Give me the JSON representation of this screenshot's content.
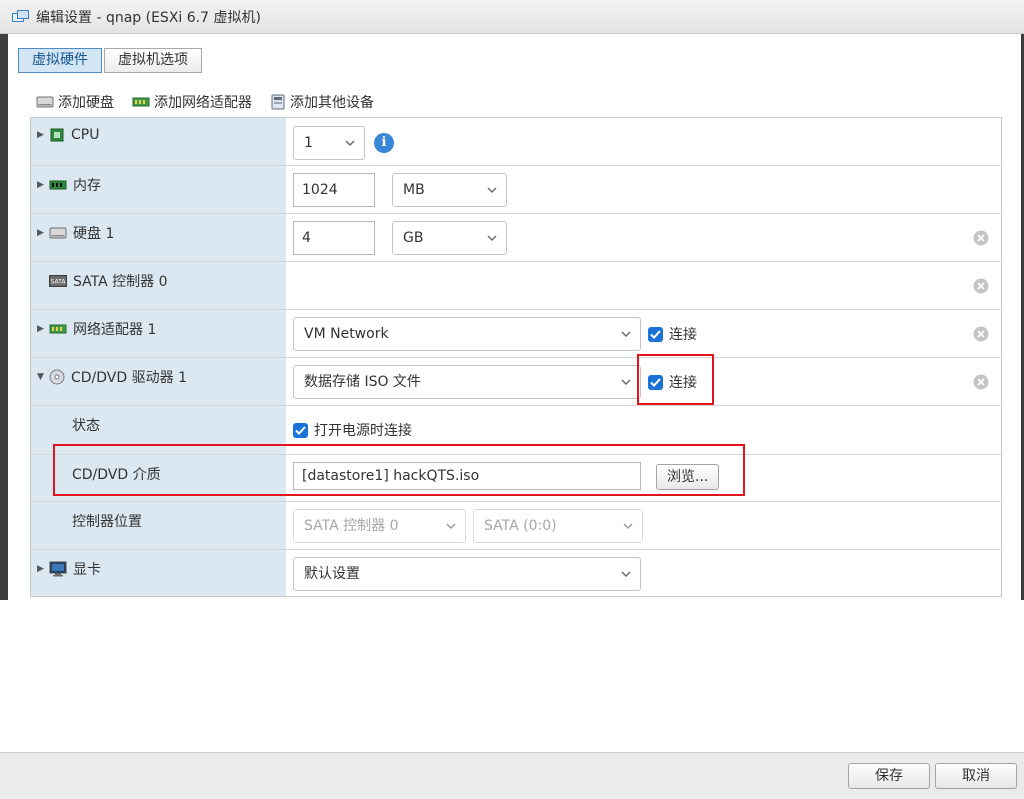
{
  "window": {
    "title": "编辑设置 - qnap (ESXi 6.7 虚拟机)"
  },
  "tabs": [
    {
      "label": "虚拟硬件",
      "active": true
    },
    {
      "label": "虚拟机选项",
      "active": false
    }
  ],
  "toolbar": {
    "add_disk": "添加硬盘",
    "add_nic": "添加网络适配器",
    "add_other": "添加其他设备"
  },
  "hardware": {
    "cpu": {
      "label": "CPU",
      "value": "1"
    },
    "memory": {
      "label": "内存",
      "value": "1024",
      "unit": "MB"
    },
    "disk": {
      "label": "硬盘 1",
      "value": "4",
      "unit": "GB"
    },
    "sata": {
      "label": "SATA 控制器 0"
    },
    "nic": {
      "label": "网络适配器 1",
      "network": "VM Network",
      "connect_label": "连接",
      "connected": true
    },
    "cdrom": {
      "label": "CD/DVD 驱动器 1",
      "source": "数据存储 ISO 文件",
      "connect_label": "连接",
      "connected": true,
      "status_label": "状态",
      "power_on_label": "打开电源时连接",
      "power_on": true,
      "media_label": "CD/DVD 介质",
      "media_path": "[datastore1] hackQTS.iso",
      "browse_label": "浏览...",
      "controller_label": "控制器位置",
      "controller": "SATA 控制器 0",
      "controller_port": "SATA (0:0)"
    },
    "video": {
      "label": "显卡",
      "value": "默认设置"
    }
  },
  "footer": {
    "save_label": "保存",
    "cancel_label": "取消"
  },
  "colors": {
    "accent": "#1a73d9",
    "highlight": "#e3141e",
    "label_bg": "#dbe8f2"
  },
  "icons": [
    "vm-icon",
    "disk-icon",
    "nic-icon",
    "device-icon",
    "cpu-icon",
    "memory-icon",
    "sata-icon",
    "cdrom-icon",
    "monitor-icon",
    "info-icon",
    "remove-icon",
    "chevron-down-icon",
    "check-icon"
  ]
}
